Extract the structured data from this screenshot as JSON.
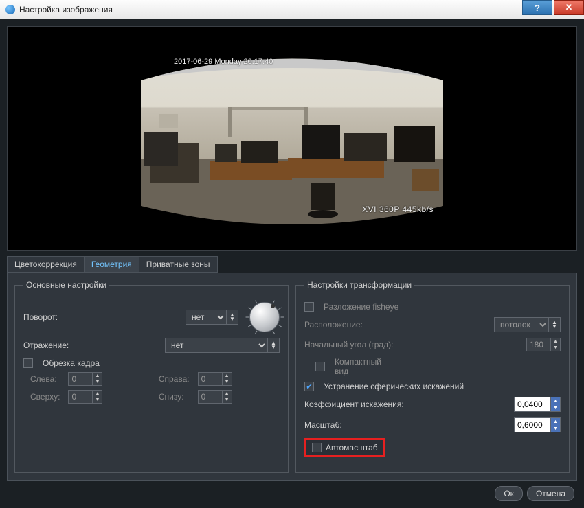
{
  "window": {
    "title": "Настройка изображения"
  },
  "tabs": {
    "color": "Цветокоррекция",
    "geometry": "Геометрия",
    "privacy": "Приватные зоны",
    "active": "geometry"
  },
  "overlay": {
    "timestamp": "2017-06-29 Monday 20:17:40",
    "bitrate": "XVI 360P 445kb/s"
  },
  "basic": {
    "legend": "Основные настройки",
    "rotation_label": "Поворот:",
    "rotation_value": "нет",
    "mirror_label": "Отражение:",
    "mirror_value": "нет",
    "crop_label": "Обрезка кадра",
    "crop_checked": false,
    "crop": {
      "left_label": "Слева:",
      "left": "0",
      "right_label": "Справа:",
      "right": "0",
      "top_label": "Сверху:",
      "top": "0",
      "bottom_label": "Снизу:",
      "bottom": "0"
    }
  },
  "transform": {
    "legend": "Настройки трансформации",
    "fisheye_label": "Разложение fisheye",
    "fisheye_checked": false,
    "placement_label": "Расположение:",
    "placement_value": "потолок",
    "start_angle_label": "Начальный угол (град):",
    "start_angle_value": "180",
    "compact_label": "Компактный вид",
    "compact_checked": false,
    "spherical_label": "Устранение сферических искажений",
    "spherical_checked": true,
    "coeff_label": "Коэффициент искажения:",
    "coeff_value": "0,0400",
    "scale_label": "Масштаб:",
    "scale_value": "0,6000",
    "autoscale_label": "Автомасштаб",
    "autoscale_checked": false
  },
  "footer": {
    "ok": "Ок",
    "cancel": "Отмена"
  }
}
